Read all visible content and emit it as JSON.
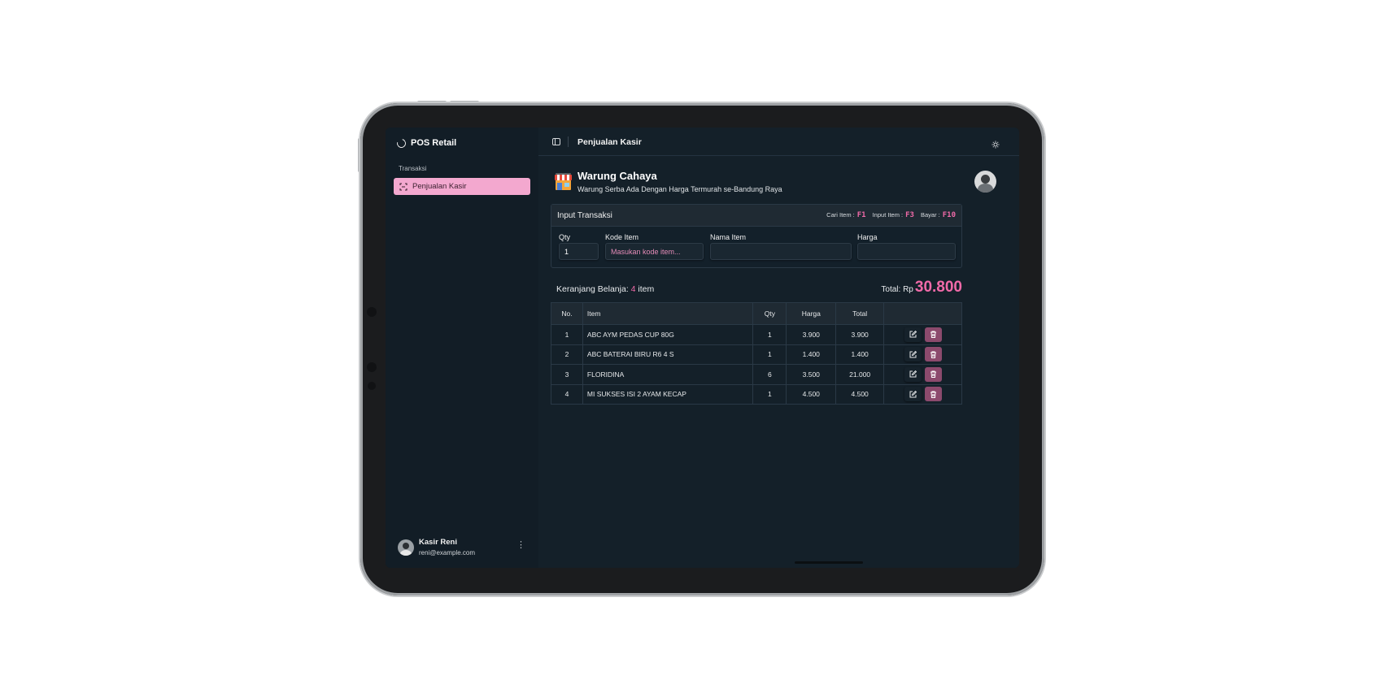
{
  "app": {
    "brand": "POS Retail"
  },
  "sidebar": {
    "group_label": "Transaksi",
    "items": [
      {
        "label": "Penjualan Kasir",
        "icon": "scan-icon",
        "active": true
      }
    ],
    "user": {
      "name": "Kasir Reni",
      "email": "reni@example.com"
    }
  },
  "header": {
    "title": "Penjualan Kasir"
  },
  "store": {
    "name": "Warung Cahaya",
    "tagline": "Warung Serba Ada Dengan Harga Termurah se-Bandung Raya"
  },
  "input_card": {
    "title": "Input Transaksi",
    "shortcuts": [
      {
        "label": "Cari Item :",
        "key": "F1"
      },
      {
        "label": "Input Item :",
        "key": "F3"
      },
      {
        "label": "Bayar :",
        "key": "F10"
      }
    ],
    "fields": {
      "qty": {
        "label": "Qty",
        "value": "1"
      },
      "kode": {
        "label": "Kode Item",
        "placeholder": "Masukan kode item..."
      },
      "nama": {
        "label": "Nama Item",
        "value": ""
      },
      "harga": {
        "label": "Harga",
        "value": ""
      }
    }
  },
  "cart": {
    "title": "Keranjang Belanja:",
    "count": "4",
    "count_suffix": "item",
    "total_label": "Total: Rp",
    "total_value": "30.800"
  },
  "table": {
    "headers": [
      "No.",
      "Item",
      "Qty",
      "Harga",
      "Total",
      ""
    ],
    "rows": [
      {
        "no": "1",
        "item": "ABC AYM PEDAS CUP 80G",
        "qty": "1",
        "harga": "3.900",
        "total": "3.900"
      },
      {
        "no": "2",
        "item": "ABC BATERAI BIRU R6 4 S",
        "qty": "1",
        "harga": "1.400",
        "total": "1.400"
      },
      {
        "no": "3",
        "item": "FLORIDINA",
        "qty": "6",
        "harga": "3.500",
        "total": "21.000"
      },
      {
        "no": "4",
        "item": "MI SUKSES ISI 2 AYAM KECAP",
        "qty": "1",
        "harga": "4.500",
        "total": "4.500"
      }
    ]
  },
  "colors": {
    "accent": "#f06aa8",
    "sidebar_active": "#f3a8cf",
    "background": "#142029"
  }
}
